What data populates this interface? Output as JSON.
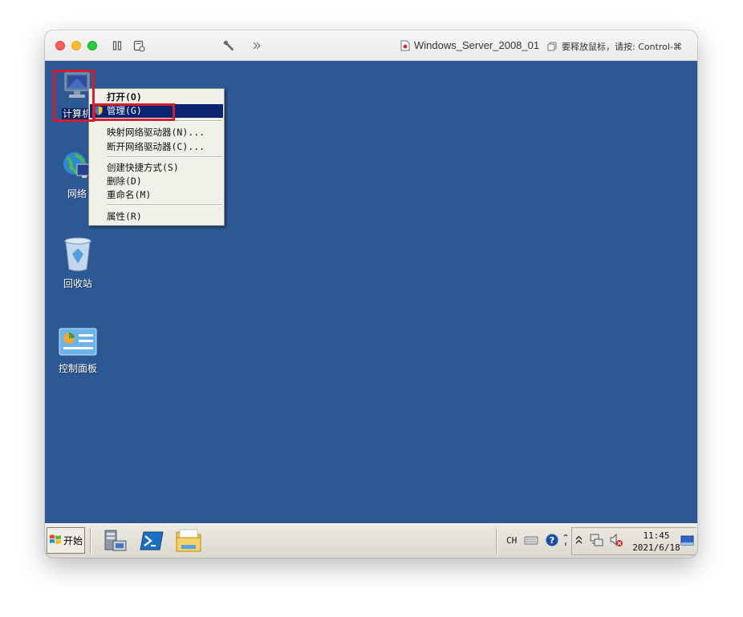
{
  "window": {
    "title": "Windows_Server_2008_01",
    "release_hint": "要释放鼠标，请按: Control-⌘"
  },
  "desktop": {
    "background_color": "#2c5994",
    "icons": [
      {
        "name": "computer",
        "label": "计算机",
        "icon": "computer-icon"
      },
      {
        "name": "network",
        "label": "网络",
        "icon": "network-globe-icon"
      },
      {
        "name": "recycle-bin",
        "label": "回收站",
        "icon": "recycle-bin-icon"
      },
      {
        "name": "control-panel",
        "label": "控制面板",
        "icon": "control-panel-icon"
      }
    ]
  },
  "context_menu": {
    "items": [
      {
        "label": "打开(O)",
        "bold": true
      },
      {
        "label": "管理(G)",
        "highlighted": true,
        "icon": "shield-icon"
      },
      {
        "label": "映射网络驱动器(N)..."
      },
      {
        "label": "断开网络驱动器(C)..."
      },
      {
        "label": "创建快捷方式(S)"
      },
      {
        "label": "删除(D)"
      },
      {
        "label": "重命名(M)"
      },
      {
        "label": "属性(R)"
      }
    ]
  },
  "taskbar": {
    "start_label": "开始",
    "quick_launch": [
      "server-manager-icon",
      "powershell-icon",
      "explorer-folder-icon"
    ],
    "tray": {
      "language": "CH",
      "clock_time": "11:45",
      "clock_date": "2021/6/18"
    }
  },
  "colors": {
    "highlight": "#0b2471",
    "annotation": "#d31f2d"
  }
}
